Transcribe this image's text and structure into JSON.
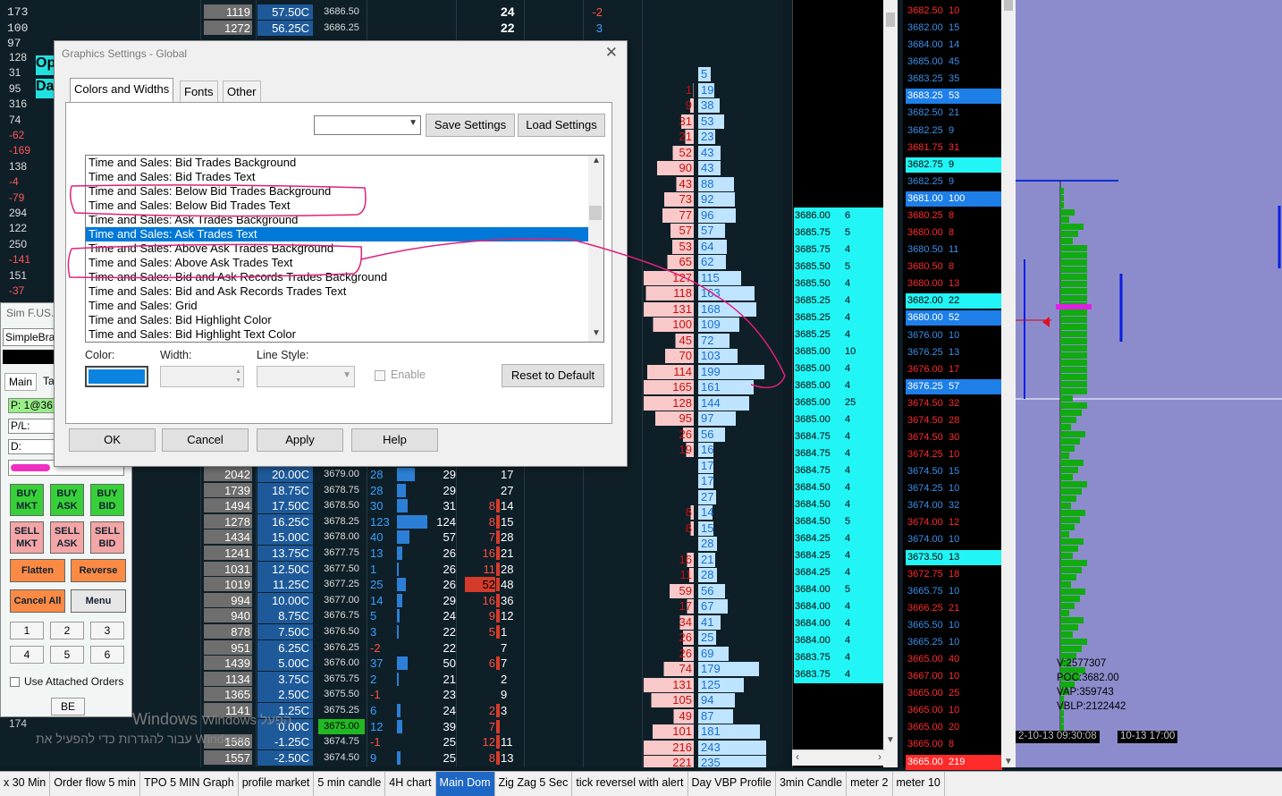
{
  "dialog": {
    "title": "Graphics Settings - Global",
    "close": "✕",
    "tabs": [
      "Colors and Widths",
      "Fonts",
      "Other"
    ],
    "save_label": "Save Settings",
    "load_label": "Load Settings",
    "items": [
      "Time and Sales: Bid Trades Background",
      "Time and Sales: Bid Trades Text",
      "Time and Sales: Below Bid Trades Background",
      "Time and Sales: Below Bid Trades Text",
      "Time and Sales: Ask Trades Background",
      "Time and Sales: Ask Trades Text",
      "Time and Sales: Above Ask Trades Background",
      "Time and Sales: Above Ask Trades Text",
      "Time and Sales: Bid and Ask Records Trades Background",
      "Time and Sales: Bid and Ask Records Trades Text",
      "Time and Sales: Grid",
      "Time and Sales: Bid Highlight Color",
      "Time and Sales: Bid Highlight Text Color"
    ],
    "selected_index": 5,
    "color_label": "Color:",
    "width_label": "Width:",
    "linestyle_label": "Line Style:",
    "enable_label": "Enable",
    "reset_label": "Reset to Default",
    "ok": "OK",
    "cancel": "Cancel",
    "apply": "Apply",
    "help": "Help",
    "swatch": "#0a84e0"
  },
  "dom_top": [
    {
      "left": "173",
      "vol": "1119",
      "pnl": "57.50C",
      "price": "3686.50",
      "tot": "24",
      "sell": "-2"
    },
    {
      "left": "100",
      "vol": "1272",
      "pnl": "56.25C",
      "price": "3686.25",
      "tot": "22",
      "sell": "3"
    },
    {
      "left": "97",
      "vol": "",
      "pnl": "",
      "price": "",
      "tot": "",
      "sell": ""
    }
  ],
  "left_col": [
    "128",
    "31",
    "95",
    "316",
    "74",
    "-62",
    "-169",
    "138",
    "-4",
    "-79",
    "294",
    "122",
    "250",
    "-141",
    "151",
    "-37"
  ],
  "dom_rows": [
    {
      "vol": "2042",
      "pnl": "20.00C",
      "price": "3679.00",
      "bid": "28",
      "bw": 20,
      "tot": "29",
      "sell": "",
      "buy": "17"
    },
    {
      "vol": "1739",
      "pnl": "18.75C",
      "price": "3678.75",
      "bid": "28",
      "bw": 10,
      "tot": "29",
      "sell": "",
      "buy": "27"
    },
    {
      "vol": "1494",
      "pnl": "17.50C",
      "price": "3678.50",
      "bid": "30",
      "bw": 12,
      "tot": "31",
      "sell": "8",
      "buy": "14"
    },
    {
      "vol": "1278",
      "pnl": "16.25C",
      "price": "3678.25",
      "bid": "123",
      "bw": 34,
      "tot": "124",
      "sell": "8",
      "buy": "15"
    },
    {
      "vol": "1434",
      "pnl": "15.00C",
      "price": "3678.00",
      "bid": "40",
      "bw": 14,
      "tot": "57",
      "sell": "7",
      "buy": "28"
    },
    {
      "vol": "1241",
      "pnl": "13.75C",
      "price": "3677.75",
      "bid": "13",
      "bw": 6,
      "tot": "26",
      "sell": "16",
      "buy": "21"
    },
    {
      "vol": "1031",
      "pnl": "12.50C",
      "price": "3677.50",
      "bid": "1",
      "bw": 2,
      "tot": "26",
      "sell": "11",
      "buy": "28"
    },
    {
      "vol": "1019",
      "pnl": "11.25C",
      "price": "3677.25",
      "bid": "25",
      "bw": 10,
      "tot": "26",
      "sell": "52",
      "buy": "48"
    },
    {
      "vol": "994",
      "pnl": "10.00C",
      "price": "3677.00",
      "bid": "14",
      "bw": 6,
      "tot": "29",
      "sell": "16",
      "buy": "36"
    },
    {
      "vol": "940",
      "pnl": "8.75C",
      "price": "3676.75",
      "bid": "5",
      "bw": 3,
      "tot": "24",
      "sell": "9",
      "buy": "12"
    },
    {
      "vol": "878",
      "pnl": "7.50C",
      "price": "3676.50",
      "bid": "3",
      "bw": 2,
      "tot": "22",
      "sell": "5",
      "buy": "1"
    },
    {
      "vol": "951",
      "pnl": "6.25C",
      "price": "3676.25",
      "bid": "-2",
      "bw": 0,
      "tot": "22",
      "sell": "",
      "buy": "7"
    },
    {
      "vol": "1439",
      "pnl": "5.00C",
      "price": "3676.00",
      "bid": "37",
      "bw": 12,
      "tot": "50",
      "sell": "6",
      "buy": "7"
    },
    {
      "vol": "1134",
      "pnl": "3.75C",
      "price": "3675.75",
      "bid": "2",
      "bw": 2,
      "tot": "21",
      "sell": "",
      "buy": "2"
    },
    {
      "vol": "1365",
      "pnl": "2.50C",
      "price": "3675.50",
      "bid": "-1",
      "bw": 0,
      "tot": "23",
      "sell": "",
      "buy": "9"
    },
    {
      "vol": "1141",
      "pnl": "1.25C",
      "price": "3675.25",
      "bid": "6",
      "bw": 4,
      "tot": "24",
      "sell": "2",
      "buy": "3"
    },
    {
      "vol": "",
      "pnl": "0.00C",
      "price": "3675.00",
      "bid": "12",
      "bw": 6,
      "tot": "39",
      "sell": "7",
      "buy": ""
    },
    {
      "vol": "1586",
      "pnl": "-1.25C",
      "price": "3674.75",
      "bid": "-1",
      "bw": 0,
      "tot": "25",
      "sell": "12",
      "buy": "11"
    },
    {
      "vol": "1557",
      "pnl": "-2.50C",
      "price": "3674.50",
      "bid": "9",
      "bw": 4,
      "tot": "25",
      "sell": "8",
      "buy": "13"
    }
  ],
  "bidask": [
    [
      "",
      "5"
    ],
    [
      "1",
      "19"
    ],
    [
      "9",
      "38"
    ],
    [
      "31",
      "53"
    ],
    [
      "21",
      "23"
    ],
    [
      "52",
      "43"
    ],
    [
      "90",
      "43"
    ],
    [
      "43",
      "88"
    ],
    [
      "73",
      "92"
    ],
    [
      "77",
      "96"
    ],
    [
      "57",
      "57"
    ],
    [
      "53",
      "64"
    ],
    [
      "65",
      "62"
    ],
    [
      "127",
      "115"
    ],
    [
      "118",
      "163"
    ],
    [
      "131",
      "168"
    ],
    [
      "100",
      "109"
    ],
    [
      "45",
      "72"
    ],
    [
      "70",
      "103"
    ],
    [
      "114",
      "199"
    ],
    [
      "165",
      "161"
    ],
    [
      "128",
      "144"
    ],
    [
      "95",
      "97"
    ],
    [
      "26",
      "56"
    ],
    [
      "19",
      "16"
    ],
    [
      "",
      "17"
    ],
    [
      "",
      "17"
    ],
    [
      "",
      "27"
    ],
    [
      "8",
      "14"
    ],
    [
      "8",
      "15"
    ],
    [
      "",
      "28"
    ],
    [
      "16",
      "21"
    ],
    [
      "11",
      "28"
    ],
    [
      "59",
      "56"
    ],
    [
      "17",
      "67"
    ],
    [
      "34",
      "41"
    ],
    [
      "26",
      "25"
    ],
    [
      "26",
      "69"
    ],
    [
      "74",
      "179"
    ],
    [
      "131",
      "125"
    ],
    [
      "105",
      "94"
    ],
    [
      "49",
      "87"
    ],
    [
      "101",
      "181"
    ],
    [
      "216",
      "243"
    ],
    [
      "221",
      "235"
    ]
  ],
  "mid_rows": [
    [
      "3686.00",
      "6"
    ],
    [
      "3685.75",
      "5"
    ],
    [
      "3685.75",
      "4"
    ],
    [
      "3685.50",
      "5"
    ],
    [
      "3685.50",
      "4"
    ],
    [
      "3685.25",
      "4"
    ],
    [
      "3685.25",
      "4"
    ],
    [
      "3685.25",
      "4"
    ],
    [
      "3685.00",
      "10"
    ],
    [
      "3685.00",
      "4"
    ],
    [
      "3685.00",
      "4"
    ],
    [
      "3685.00",
      "25"
    ],
    [
      "3685.00",
      "4"
    ],
    [
      "3684.75",
      "4"
    ],
    [
      "3684.75",
      "4"
    ],
    [
      "3684.75",
      "4"
    ],
    [
      "3684.50",
      "4"
    ],
    [
      "3684.50",
      "4"
    ],
    [
      "3684.50",
      "5"
    ],
    [
      "3684.25",
      "4"
    ],
    [
      "3684.25",
      "4"
    ],
    [
      "3684.25",
      "4"
    ],
    [
      "3684.00",
      "5"
    ],
    [
      "3684.00",
      "4"
    ],
    [
      "3684.00",
      "4"
    ],
    [
      "3684.00",
      "4"
    ],
    [
      "3683.75",
      "4"
    ],
    [
      "3683.75",
      "4"
    ]
  ],
  "price_rows": [
    [
      "3682.50",
      "10",
      "r"
    ],
    [
      "3682.00",
      "15",
      "b"
    ],
    [
      "3684.00",
      "14",
      "b"
    ],
    [
      "3685.00",
      "45",
      "b"
    ],
    [
      "3683.25",
      "35",
      "b"
    ],
    [
      "3683.25",
      "53",
      "B"
    ],
    [
      "3682.50",
      "21",
      "b"
    ],
    [
      "3682.25",
      "9",
      "b"
    ],
    [
      "3681.75",
      "31",
      "r"
    ],
    [
      "3682.75",
      "9",
      "C"
    ],
    [
      "3682.25",
      "9",
      "b"
    ],
    [
      "3681.00",
      "100",
      "B"
    ],
    [
      "3680.25",
      "8",
      "r"
    ],
    [
      "3680.00",
      "8",
      "r"
    ],
    [
      "3680.50",
      "11",
      "b"
    ],
    [
      "3680.50",
      "8",
      "r"
    ],
    [
      "3680.00",
      "13",
      "r"
    ],
    [
      "3682.00",
      "22",
      "C"
    ],
    [
      "3680.00",
      "52",
      "B"
    ],
    [
      "3676.00",
      "10",
      "b"
    ],
    [
      "3676.25",
      "13",
      "b"
    ],
    [
      "3676.00",
      "17",
      "r"
    ],
    [
      "3676.25",
      "57",
      "B"
    ],
    [
      "3674.50",
      "32",
      "r"
    ],
    [
      "3674.50",
      "28",
      "r"
    ],
    [
      "3674.50",
      "30",
      "r"
    ],
    [
      "3674.25",
      "10",
      "r"
    ],
    [
      "3674.50",
      "15",
      "b"
    ],
    [
      "3674.25",
      "10",
      "b"
    ],
    [
      "3674.00",
      "32",
      "b"
    ],
    [
      "3674.00",
      "12",
      "r"
    ],
    [
      "3674.00",
      "10",
      "b"
    ],
    [
      "3673.50",
      "13",
      "C"
    ],
    [
      "3672.75",
      "18",
      "r"
    ],
    [
      "3665.75",
      "10",
      "b"
    ],
    [
      "3666.25",
      "21",
      "r"
    ],
    [
      "3665.50",
      "10",
      "b"
    ],
    [
      "3665.25",
      "10",
      "b"
    ],
    [
      "3665.00",
      "40",
      "r"
    ],
    [
      "3667.00",
      "10",
      "r"
    ],
    [
      "3665.00",
      "25",
      "r"
    ],
    [
      "3665.00",
      "10",
      "r"
    ],
    [
      "3665.00",
      "20",
      "r"
    ],
    [
      "3665.00",
      "8",
      "r"
    ],
    [
      "3665.00",
      "219",
      "R"
    ]
  ],
  "profile": {
    "stats": [
      "V:2577307",
      "POC:3682.00",
      "VAP:359743",
      "VBLP:2122442"
    ],
    "date1": "2-10-13  09:30:08",
    "date2": "10-13  17:00"
  },
  "order_entry": {
    "title": "Sim F.US.E",
    "dropdown": "SimpleBra",
    "tab_main": "Main",
    "tab_ta": "Ta",
    "p": "P: 1@36",
    "pl": "P/L:",
    "d": "D:",
    "buy_mkt": "BUY MKT",
    "buy_ask": "BUY ASK",
    "buy_bid": "BUY BID",
    "sell_mkt": "SELL MKT",
    "sell_ask": "SELL ASK",
    "sell_bid": "SELL BID",
    "flatten": "Flatten",
    "reverse": "Reverse",
    "cancel_all": "Cancel All",
    "menu": "Menu",
    "nums": [
      "1",
      "2",
      "3",
      "4",
      "5",
      "6"
    ],
    "attached": "Use Attached Orders",
    "be": "BE"
  },
  "overlay_texts": [
    "Windows",
    "Op",
    "Da",
    "174"
  ],
  "windows_note": "Windows הפעל",
  "windows_hint": "עבור להגדרות כדי להפעיל את Windows.",
  "taskbar": [
    "x 30 Min",
    "Order flow 5 min",
    "TPO 5 MIN Graph",
    "profile market",
    "5 min candle",
    "4H chart",
    "Main Dom",
    "Zig Zag 5 Sec",
    "tick reversel with alert",
    "Day VBP Profile",
    "3min Candle",
    "meter 2",
    "meter 10"
  ],
  "taskbar_active": 6
}
